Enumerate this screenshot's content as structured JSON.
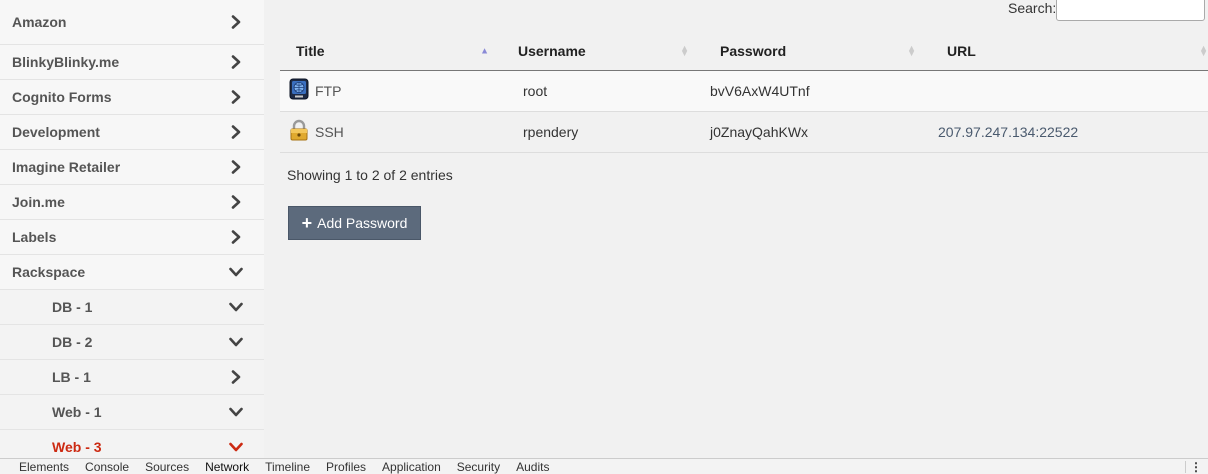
{
  "sidebar": {
    "items": [
      {
        "label": "Amazon",
        "state": "collapsed"
      },
      {
        "label": "BlinkyBlinky.me",
        "state": "collapsed"
      },
      {
        "label": "Cognito Forms",
        "state": "collapsed"
      },
      {
        "label": "Development",
        "state": "collapsed"
      },
      {
        "label": "Imagine Retailer",
        "state": "collapsed"
      },
      {
        "label": "Join.me",
        "state": "collapsed"
      },
      {
        "label": "Labels",
        "state": "collapsed"
      },
      {
        "label": "Rackspace",
        "state": "expanded"
      }
    ],
    "subitems": [
      {
        "label": "DB - 1",
        "state": "expanded"
      },
      {
        "label": "DB - 2",
        "state": "expanded"
      },
      {
        "label": "LB - 1",
        "state": "collapsed"
      },
      {
        "label": "Web - 1",
        "state": "expanded"
      },
      {
        "label": "Web - 3",
        "state": "expanded",
        "active": true
      }
    ],
    "active_color": "#cc2a12"
  },
  "search": {
    "label": "Search:",
    "value": ""
  },
  "table": {
    "columns": [
      "Title",
      "Username",
      "Password",
      "URL"
    ],
    "rows": [
      {
        "icon": "ftp-globe-icon",
        "title": "FTP",
        "username": "root",
        "password": "bvV6AxW4UTnf",
        "url": ""
      },
      {
        "icon": "padlock-icon",
        "title": "SSH",
        "username": "rpendery",
        "password": "j0ZnayQahKWx",
        "url": "207.97.247.134:22522"
      }
    ]
  },
  "info": "Showing 1 to 2 of 2 entries",
  "add_button": {
    "label": "Add Password",
    "color": "#5c6a7c"
  },
  "devtools": {
    "tabs": [
      "Elements",
      "Console",
      "Sources",
      "Network",
      "Timeline",
      "Profiles",
      "Application",
      "Security",
      "Audits"
    ],
    "active": "Network"
  }
}
